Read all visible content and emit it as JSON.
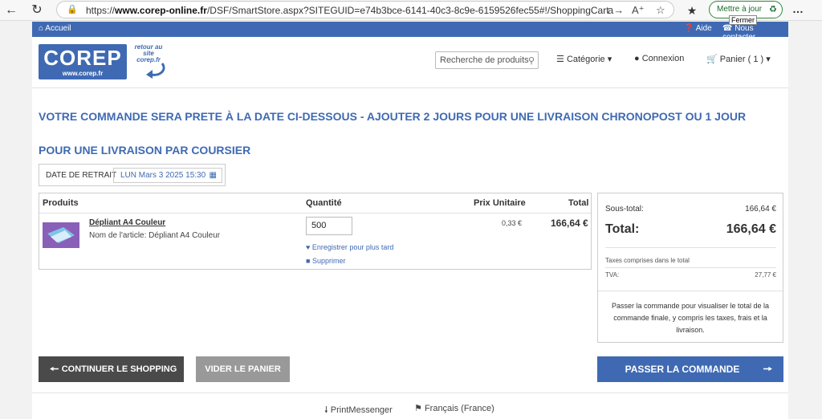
{
  "browser": {
    "url_prefix": "https://",
    "url_domain": "www.corep-online.fr",
    "url_path": "/DSF/SmartStore.aspx?SITEGUID=e74b3bce-6141-40c3-8c9e-6159526fec55#!/ShoppingCart",
    "update_label": "Mettre à jour",
    "tooltip": "Fermer"
  },
  "topbar": {
    "home": "Accueil",
    "help": "Aide",
    "contact": "Nous contacter"
  },
  "header": {
    "logo_text": "COREP",
    "logo_url": "www.corep.fr",
    "back_line1": "retour au",
    "back_line2": "site",
    "back_line3": "corep.fr",
    "search_placeholder": "Recherche de produits",
    "category": "Catégorie",
    "login": "Connexion",
    "cart": "Panier",
    "cart_count": "( 1 )"
  },
  "notice": "VOTRE COMMANDE SERA PRETE À LA DATE CI-DESSOUS - AJOUTER 2 JOURS POUR UNE LIVRAISON CHRONOPOST OU 1 JOUR POUR UNE LIVRAISON PAR COURSIER",
  "pickup": {
    "label": "DATE DE RETRAIT",
    "value": "LUN Mars 3 2025 15:30"
  },
  "table": {
    "headers": {
      "products": "Produits",
      "quantity": "Quantité",
      "unit_price": "Prix Unitaire",
      "total": "Total"
    },
    "rows": [
      {
        "name": "Dépliant A4 Couleur",
        "description": "Nom de l'article: Dépliant A4 Couleur",
        "quantity": "500",
        "save_later": "Enregistrer pour plus tard",
        "delete": "Supprimer",
        "unit_price": "0,33 €",
        "total": "166,64 €"
      }
    ]
  },
  "summary": {
    "subtotal_label": "Sous-total:",
    "subtotal_value": "166,64 €",
    "total_label": "Total:",
    "total_value": "166,64 €",
    "taxes_label": "Taxes comprises dans le total",
    "tva_label": "TVA:",
    "tva_value": "27,77 €",
    "note": "Passer la commande pour visualiser le total de la commande finale, y compris les taxes, frais et la livraison."
  },
  "buttons": {
    "continue": "CONTINUER LE SHOPPING",
    "clear": "VIDER LE PANIER",
    "checkout": "PASSER LA COMMANDE"
  },
  "footer": {
    "print_messenger": "PrintMessenger",
    "language": "Français (France)"
  },
  "colors": {
    "brand_blue": "#3f6ab3",
    "dark_button": "#4a4a4a",
    "grey_button": "#999999"
  }
}
